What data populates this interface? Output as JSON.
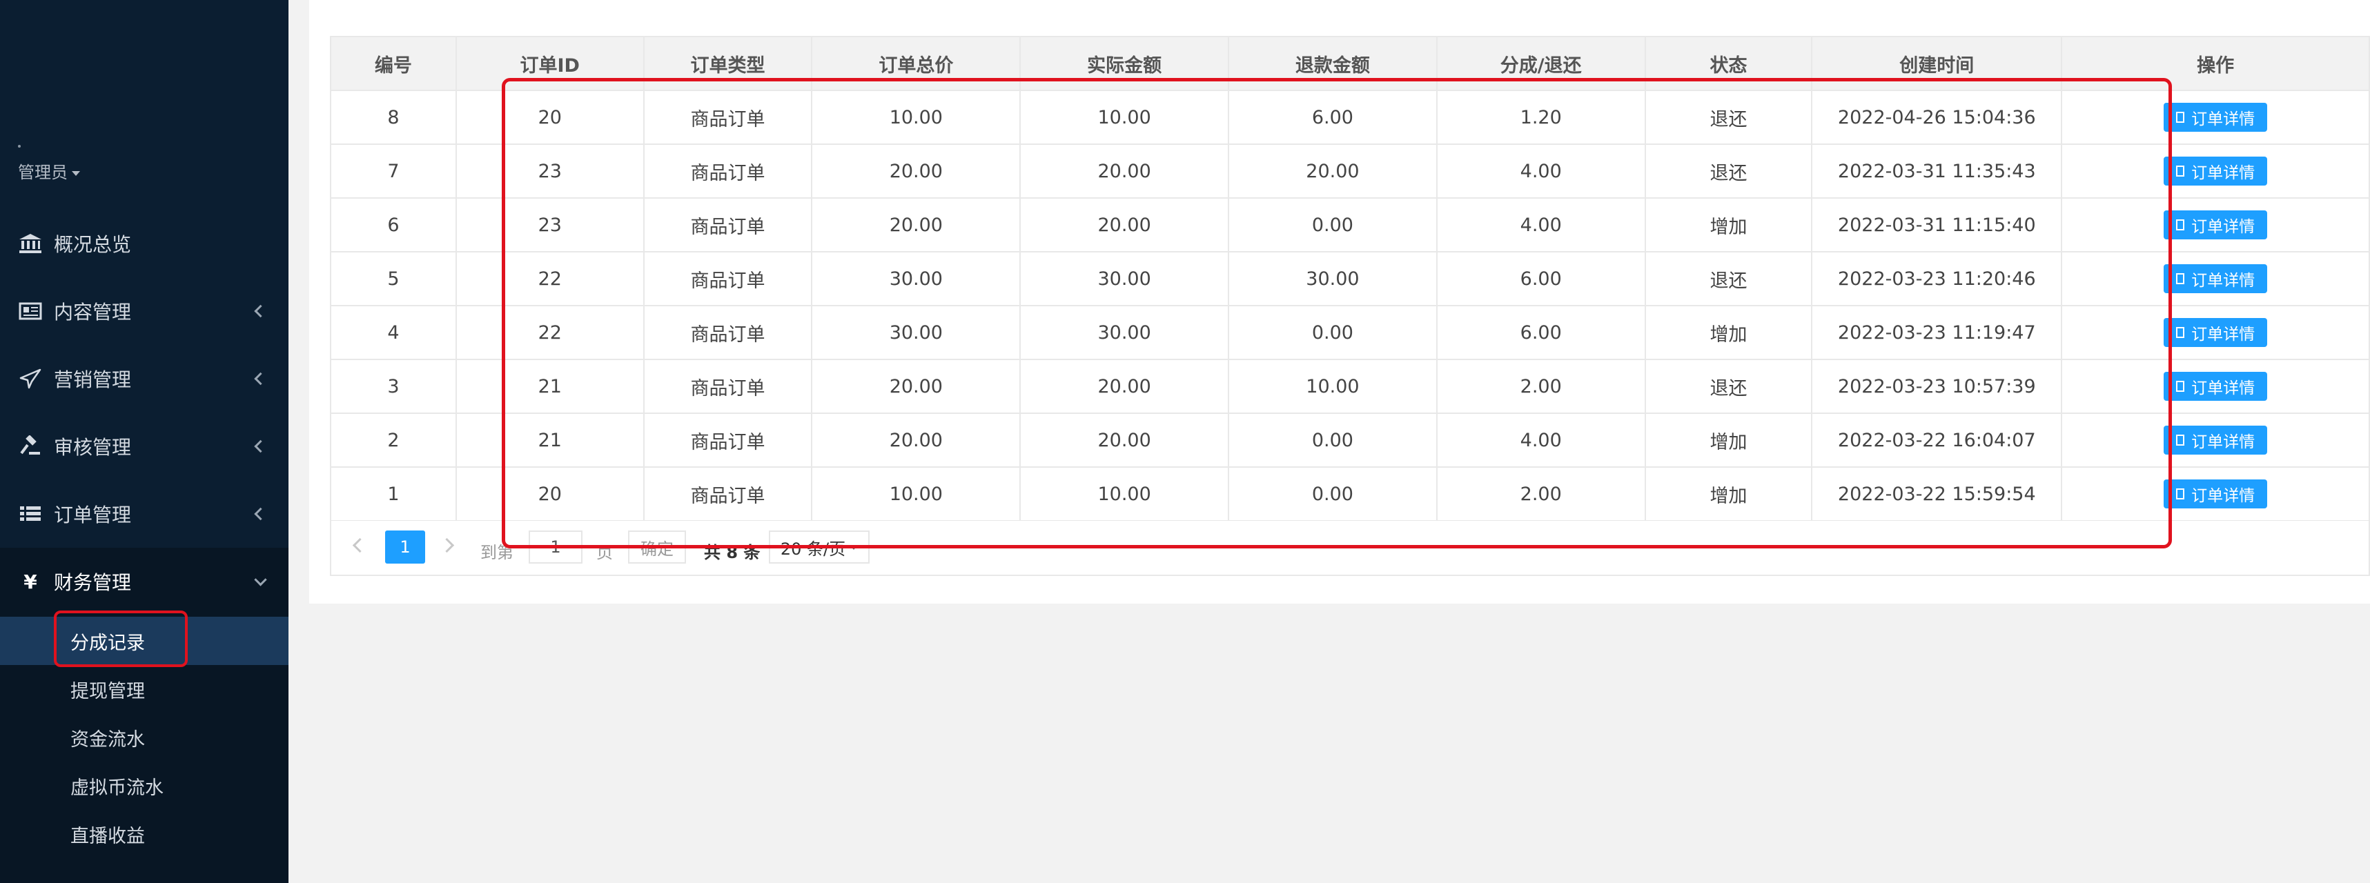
{
  "sidebar": {
    "user": "管理员",
    "items": [
      {
        "label": "概况总览",
        "icon": "bank-icon"
      },
      {
        "label": "内容管理",
        "icon": "newspaper-icon"
      },
      {
        "label": "营销管理",
        "icon": "paper-plane-icon"
      },
      {
        "label": "审核管理",
        "icon": "gavel-icon"
      },
      {
        "label": "订单管理",
        "icon": "list-icon"
      },
      {
        "label": "财务管理",
        "icon": "yen-icon"
      }
    ],
    "submenu": [
      "分成记录",
      "提现管理",
      "资金流水",
      "虚拟币流水",
      "直播收益"
    ]
  },
  "table": {
    "headers": [
      "编号",
      "订单ID",
      "订单类型",
      "订单总价",
      "实际金额",
      "退款金额",
      "分成/退还",
      "状态",
      "创建时间",
      "操作"
    ],
    "rows": [
      [
        "8",
        "20",
        "商品订单",
        "10.00",
        "10.00",
        "6.00",
        "1.20",
        "退还",
        "2022-04-26 15:04:36"
      ],
      [
        "7",
        "23",
        "商品订单",
        "20.00",
        "20.00",
        "20.00",
        "4.00",
        "退还",
        "2022-03-31 11:35:43"
      ],
      [
        "6",
        "23",
        "商品订单",
        "20.00",
        "20.00",
        "0.00",
        "4.00",
        "增加",
        "2022-03-31 11:15:40"
      ],
      [
        "5",
        "22",
        "商品订单",
        "30.00",
        "30.00",
        "30.00",
        "6.00",
        "退还",
        "2022-03-23 11:20:46"
      ],
      [
        "4",
        "22",
        "商品订单",
        "30.00",
        "30.00",
        "0.00",
        "6.00",
        "增加",
        "2022-03-23 11:19:47"
      ],
      [
        "3",
        "21",
        "商品订单",
        "20.00",
        "20.00",
        "10.00",
        "2.00",
        "退还",
        "2022-03-23 10:57:39"
      ],
      [
        "2",
        "21",
        "商品订单",
        "20.00",
        "20.00",
        "0.00",
        "4.00",
        "增加",
        "2022-03-22 16:04:07"
      ],
      [
        "1",
        "20",
        "商品订单",
        "10.00",
        "10.00",
        "0.00",
        "2.00",
        "增加",
        "2022-03-22 15:59:54"
      ]
    ],
    "action_label": "订单详情",
    "status_colors": {
      "退还": "#e0421a",
      "增加": "#0f8f8a"
    }
  },
  "pager": {
    "current": "1",
    "goto": "到第",
    "page_input": "1",
    "page_unit": "页",
    "confirm": "确定",
    "total": "共 8 条",
    "per_page": "20 条/页"
  }
}
